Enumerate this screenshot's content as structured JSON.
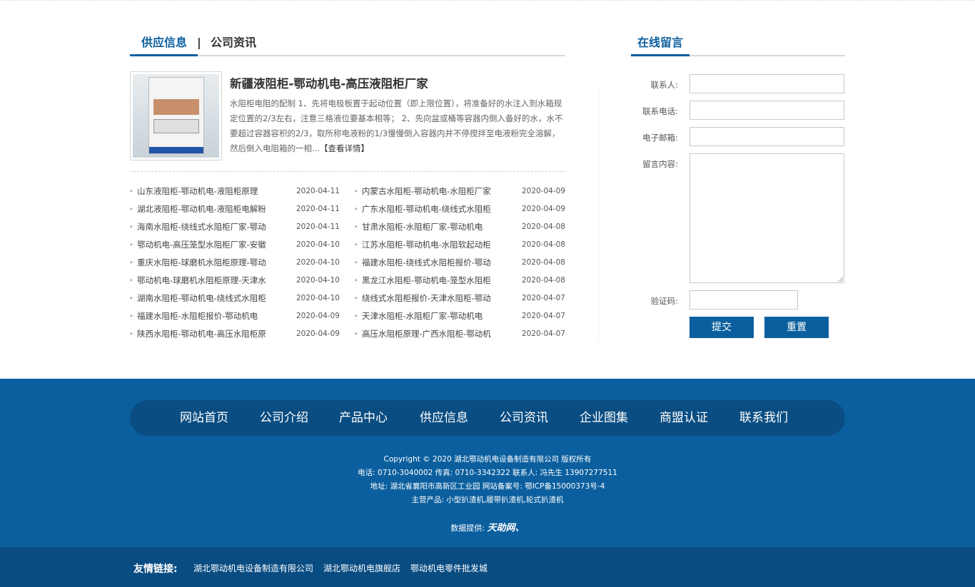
{
  "news": {
    "tab_active": "供应信息",
    "tab_separator": "|",
    "tab_other": "公司资讯",
    "feature": {
      "title": "新疆液阻柜-鄂动机电-高压液阻柜厂家",
      "desc": "水阻柜电阻的配制 1、先将电极板置于起动位置（即上限位置），将准备好的水注入到水箱规定位置的2/3左右，注意三格液位要基本相等； 2、先向盆或桶等容器内倒入备好的水，水不要超过容器容积的2/3，取所称电液粉的1/3慢慢倒入容器内并不停搅拌至电液粉完全溶解，然后倒入电阻箱的一相...",
      "more": "【查看详情】"
    },
    "left_list": [
      {
        "title": "山东液阻柜-鄂动机电-液阻柜原理",
        "date": "2020-04-11"
      },
      {
        "title": "湖北液阻柜-鄂动机电-液阻柜电解粉",
        "date": "2020-04-11"
      },
      {
        "title": "海南水阻柜-绕线式水阻柜厂家-鄂动",
        "date": "2020-04-11"
      },
      {
        "title": "鄂动机电-高压笼型水阻柜厂家-安徽",
        "date": "2020-04-10"
      },
      {
        "title": "重庆水阻柜-球磨机水阻柜原理-鄂动",
        "date": "2020-04-10"
      },
      {
        "title": "鄂动机电-球磨机水阻柜原理-天津水",
        "date": "2020-04-10"
      },
      {
        "title": "湖南水阻柜-鄂动机电-绕线式水阻柜",
        "date": "2020-04-10"
      },
      {
        "title": "福建水阻柜-水阻柜报价-鄂动机电",
        "date": "2020-04-09"
      },
      {
        "title": "陕西水阻柜-鄂动机电-高压水阻柜原",
        "date": "2020-04-09"
      }
    ],
    "right_list": [
      {
        "title": "内蒙古水阻柜-鄂动机电-水阻柜厂家",
        "date": "2020-04-09"
      },
      {
        "title": "广东水阻柜-鄂动机电-绕线式水阻柜",
        "date": "2020-04-09"
      },
      {
        "title": "甘肃水阻柜-水阻柜厂家-鄂动机电",
        "date": "2020-04-08"
      },
      {
        "title": "江苏水阻柜-鄂动机电-水阻软起动柜",
        "date": "2020-04-08"
      },
      {
        "title": "福建水阻柜-绕线式水阻柜报价-鄂动",
        "date": "2020-04-08"
      },
      {
        "title": "黑龙江水阻柜-鄂动机电-笼型水阻柜",
        "date": "2020-04-08"
      },
      {
        "title": "绕线式水阻柜报价-天津水阻柜-鄂动",
        "date": "2020-04-07"
      },
      {
        "title": "天津水阻柜-水阻柜厂家-鄂动机电",
        "date": "2020-04-07"
      },
      {
        "title": "高压水阻柜原理-广西水阻柜-鄂动机",
        "date": "2020-04-07"
      }
    ]
  },
  "message": {
    "title": "在线留言",
    "contact_label": "联系人:",
    "phone_label": "联系电话:",
    "email_label": "电子邮箱:",
    "content_label": "留言内容:",
    "captcha_label": "验证码:",
    "submit": "提交",
    "reset": "重置"
  },
  "footer": {
    "nav": [
      "网站首页",
      "公司介绍",
      "产品中心",
      "供应信息",
      "公司资讯",
      "企业图集",
      "商盟认证",
      "联系我们"
    ],
    "copyright": "Copyright © 2020   湖北鄂动机电设备制造有限公司  版权所有",
    "contact": "电话: 0710-3040002   传真: 0710-3342322  联系人: 冯先生 13907277511",
    "address": "地址:  湖北省襄阳市高新区工业园  网站备案号: 鄂ICP备15000373号-4",
    "products": "主营产品:  小型扒渣机,履带扒渣机,轮式扒渣机",
    "provider_label": "数据提供:",
    "provider_name": "天助网、",
    "friends_label": "友情链接:",
    "friends": [
      "湖北鄂动机电设备制造有限公司",
      "湖北鄂动机电旗舰店",
      "鄂动机电零件批发城"
    ]
  },
  "colors": {
    "accent": "#0b5f9e",
    "footer_nav": "#0a4d82",
    "friends_bar": "#094c82"
  }
}
